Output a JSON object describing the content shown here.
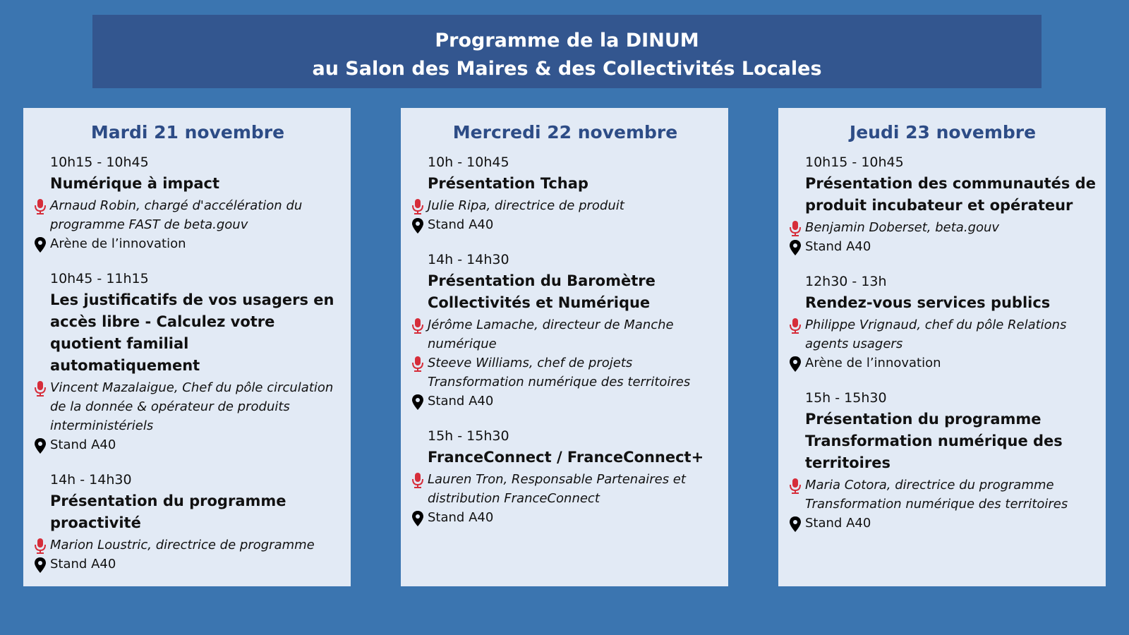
{
  "header": {
    "line1": "Programme de la DINUM",
    "line2": "au Salon des Maires & des Collectivités Locales"
  },
  "colors": {
    "background": "#3b75b0",
    "header_bg": "#33568f",
    "card_bg": "#e2eaf5",
    "day_title": "#2d4c86",
    "mic_icon": "#d62d3a",
    "pin_icon": "#000000"
  },
  "icons": {
    "speaker": "microphone-icon",
    "location": "map-pin-icon"
  },
  "days": [
    {
      "title": "Mardi 21 novembre",
      "sessions": [
        {
          "time": "10h15 - 10h45",
          "title": "Numérique à impact",
          "speakers": [
            "Arnaud Robin, chargé d'accélération du programme FAST de beta.gouv"
          ],
          "location": "Arène de l’innovation"
        },
        {
          "time": "10h45 - 11h15",
          "title": "Les justificatifs de vos usagers en accès libre - Calculez votre quotient familial automatiquement",
          "speakers": [
            "Vincent Mazalaigue, Chef du pôle circulation de la donnée & opérateur de produits interministériels"
          ],
          "location": "Stand A40"
        },
        {
          "time": "14h - 14h30",
          "title": "Présentation du programme proactivité",
          "speakers": [
            "Marion Loustric, directrice de programme"
          ],
          "location": "Stand A40"
        }
      ]
    },
    {
      "title": "Mercredi 22 novembre",
      "sessions": [
        {
          "time": "10h - 10h45",
          "title": "Présentation Tchap",
          "speakers": [
            "Julie Ripa, directrice de produit"
          ],
          "location": "Stand A40"
        },
        {
          "time": "14h - 14h30",
          "title": "Présentation du Baromètre Collectivités et Numérique",
          "speakers": [
            "Jérôme Lamache, directeur de Manche numérique",
            "Steeve Williams, chef de projets Transformation numérique des territoires"
          ],
          "location": "Stand A40"
        },
        {
          "time": "15h - 15h30",
          "title": "FranceConnect / FranceConnect+",
          "speakers": [
            "Lauren Tron, Responsable Partenaires et distribution FranceConnect"
          ],
          "location": "Stand A40"
        }
      ]
    },
    {
      "title": "Jeudi 23 novembre",
      "sessions": [
        {
          "time": "10h15 - 10h45",
          "title": "Présentation des communautés de produit incubateur et opérateur",
          "speakers": [
            "Benjamin Doberset, beta.gouv"
          ],
          "location": "Stand A40"
        },
        {
          "time": "12h30 - 13h",
          "title": "Rendez-vous services publics",
          "speakers": [
            "Philippe Vrignaud, chef du pôle Relations agents usagers"
          ],
          "location": "Arène de l’innovation"
        },
        {
          "time": "15h - 15h30",
          "title": "Présentation du programme Transformation numérique des territoires",
          "speakers": [
            "Maria Cotora, directrice du programme Transformation numérique des territoires"
          ],
          "location": "Stand A40"
        }
      ]
    }
  ]
}
